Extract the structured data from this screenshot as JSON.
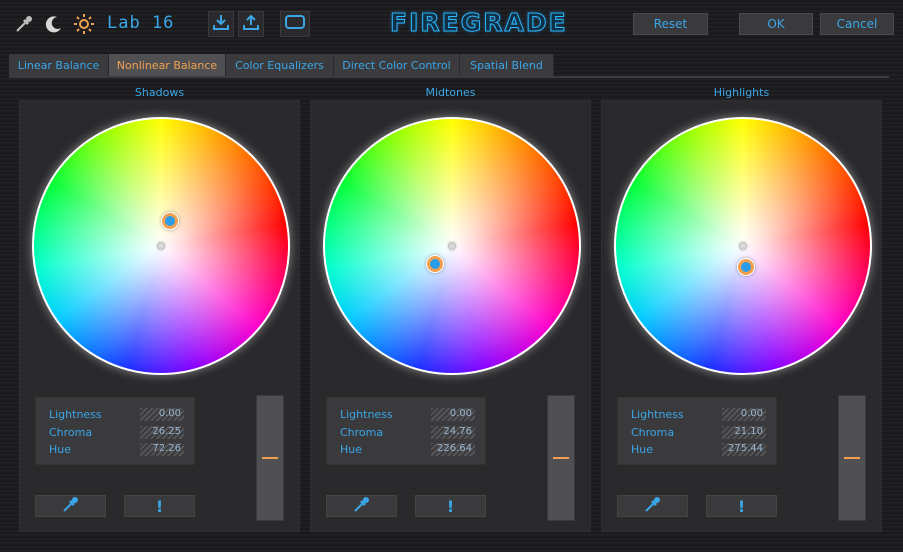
{
  "toolbar": {
    "color_space_label": "Lab 16",
    "icons": [
      "eyedropper-icon",
      "moon-icon",
      "sun-icon",
      "import-icon",
      "export-icon",
      "frame-icon"
    ],
    "logo_text": "FIREGRADE",
    "reset_label": "Reset",
    "ok_label": "OK",
    "cancel_label": "Cancel"
  },
  "tabs": [
    {
      "label": "Linear Balance",
      "active": false
    },
    {
      "label": "Nonlinear Balance",
      "active": true
    },
    {
      "label": "Color Equalizers",
      "active": false
    },
    {
      "label": "Direct Color Control",
      "active": false
    },
    {
      "label": "Spatial Blend",
      "active": false
    }
  ],
  "panels": [
    {
      "title": "Shadows",
      "lightness_label": "Lightness",
      "lightness": "0.00",
      "chroma_label": "Chroma",
      "chroma": "26.25",
      "hue_label": "Hue",
      "hue": "72.26"
    },
    {
      "title": "Midtones",
      "lightness_label": "Lightness",
      "lightness": "0.00",
      "chroma_label": "Chroma",
      "chroma": "24.76",
      "hue_label": "Hue",
      "hue": "226.64"
    },
    {
      "title": "Highlights",
      "lightness_label": "Lightness",
      "lightness": "0.00",
      "chroma_label": "Chroma",
      "chroma": "21.10",
      "hue_label": "Hue",
      "hue": "275.44"
    }
  ],
  "panel_buttons": {
    "picker_icon": "eyedropper-icon",
    "alert_label": "!"
  },
  "colors": {
    "accent": "#3aa6e8",
    "active_tab_text": "#f0a050",
    "handle_ring": "#f2a050"
  }
}
